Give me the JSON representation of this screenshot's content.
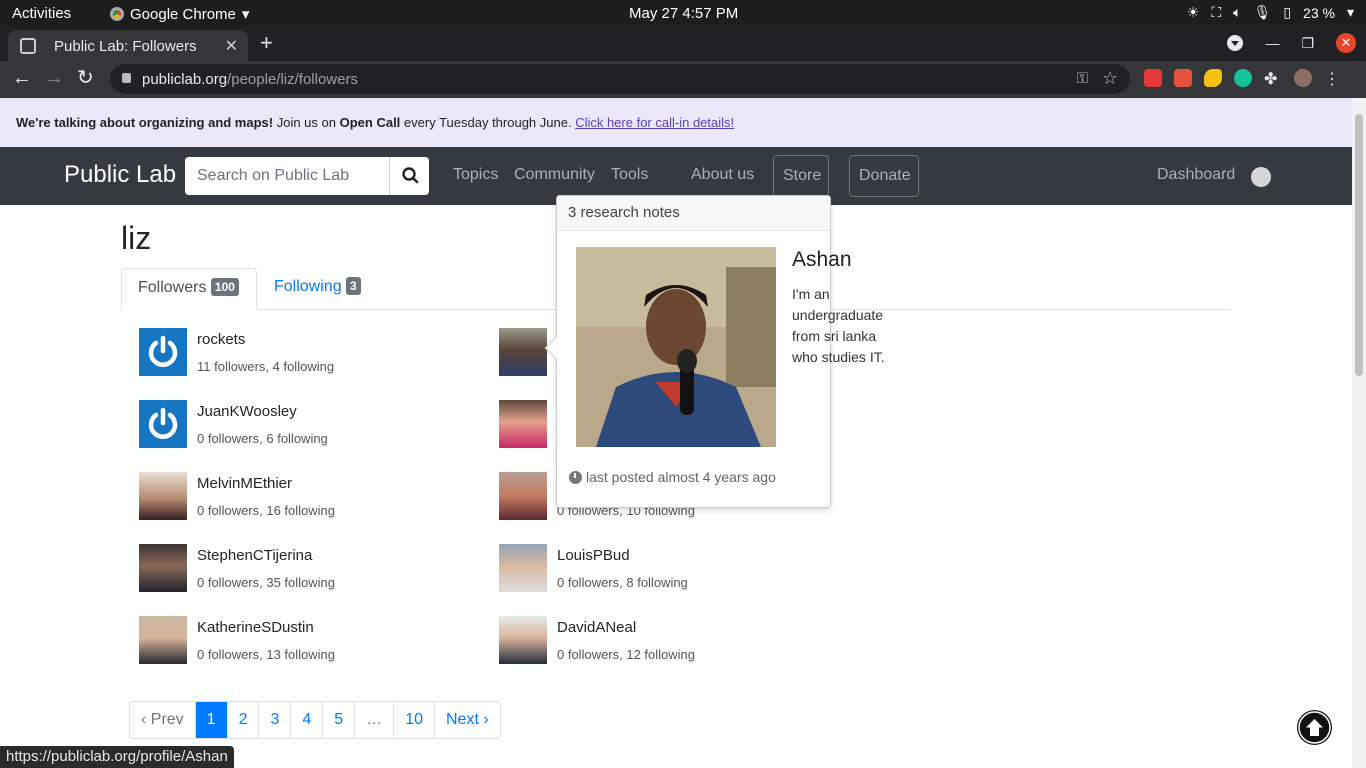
{
  "system": {
    "activities": "Activities",
    "app_name": "Google Chrome",
    "clock": "May 27   4:57 PM",
    "battery": "23 %"
  },
  "browser": {
    "tab_title": "Public Lab: Followers",
    "url_domain": "publiclab.org",
    "url_path": "/people/liz/followers",
    "status_url": "https://publiclab.org/profile/Ashan"
  },
  "banner": {
    "bold1": "We're talking about organizing and maps!",
    "text1": " Join us on ",
    "bold2": "Open Call",
    "text2": " every Tuesday through June. ",
    "link": "Click here for call-in details!"
  },
  "navbar": {
    "brand": "Public Lab",
    "search_placeholder": "Search on Public Lab",
    "links": [
      "Topics",
      "Community",
      "Tools",
      "About us"
    ],
    "store": "Store",
    "donate": "Donate",
    "dashboard": "Dashboard"
  },
  "profile": {
    "username": "liz",
    "tab_followers": "Followers",
    "followers_count": "100",
    "tab_following": "Following",
    "following_count": "3"
  },
  "people_left": [
    {
      "name": "rockets",
      "stats": "11 followers, 4 following",
      "avatar": "power-icon"
    },
    {
      "name": "JuanKWoosley",
      "stats": "0 followers, 6 following",
      "avatar": "power-icon"
    },
    {
      "name": "MelvinMEthier",
      "stats": "0 followers, 16 following",
      "avatar": "photo"
    },
    {
      "name": "StephenCTijerina",
      "stats": "0 followers, 35 following",
      "avatar": "photo"
    },
    {
      "name": "KatherineSDustin",
      "stats": "0 followers, 13 following",
      "avatar": "photo"
    }
  ],
  "people_right": [
    {
      "name": "",
      "stats": "0 followers, 10 following",
      "avatar": "photo"
    },
    {
      "name": "LouisPBud",
      "stats": "0 followers, 8 following",
      "avatar": "photo"
    },
    {
      "name": "DavidANeal",
      "stats": "0 followers, 12 following",
      "avatar": "photo"
    }
  ],
  "pagination": [
    "‹ Prev",
    "1",
    "2",
    "3",
    "4",
    "5",
    "…",
    "10",
    "Next ›"
  ],
  "popover": {
    "header": "3 research notes",
    "name": "Ashan",
    "bio": "I'm an undergraduate from sri lanka who studies IT.",
    "last_posted": "last posted almost 4 years ago"
  },
  "colors": {
    "navbar_bg": "#343a40",
    "banner_bg": "#ece8fb",
    "link_blue": "#007bff",
    "avatar_blue": "#1577c4"
  }
}
